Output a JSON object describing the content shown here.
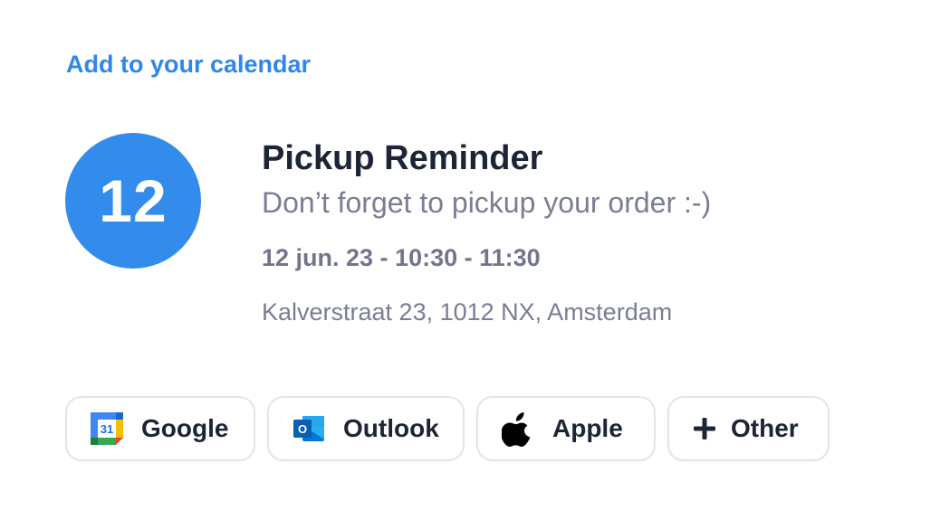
{
  "header": {
    "link_label": "Add to your calendar"
  },
  "event": {
    "day": "12",
    "title": "Pickup Reminder",
    "description": "Don’t forget to pickup your order :-)",
    "datetime": "12 jun. 23 - 10:30 - 11:30",
    "location": "Kalverstraat 23, 1012 NX, Amsterdam"
  },
  "calendar_options": [
    {
      "label": "Google",
      "icon": "google-calendar-icon",
      "icon_text": "31"
    },
    {
      "label": "Outlook",
      "icon": "outlook-icon",
      "icon_text": "O"
    },
    {
      "label": "Apple",
      "icon": "apple-icon"
    },
    {
      "label": "Other",
      "icon": "plus-icon"
    }
  ],
  "colors": {
    "accent": "#2f86eb",
    "badge": "#338cec",
    "title": "#1c2436",
    "muted": "#7a7e94",
    "button_border": "#e3e5ea"
  }
}
